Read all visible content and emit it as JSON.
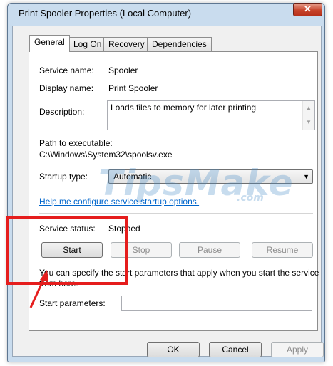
{
  "window": {
    "title": "Print Spooler Properties (Local Computer)",
    "close_glyph": "✕"
  },
  "tabs": [
    {
      "label": "General",
      "active": true
    },
    {
      "label": "Log On",
      "active": false
    },
    {
      "label": "Recovery",
      "active": false
    },
    {
      "label": "Dependencies",
      "active": false
    }
  ],
  "general": {
    "service_name_label": "Service name:",
    "service_name_value": "Spooler",
    "display_name_label": "Display name:",
    "display_name_value": "Print Spooler",
    "description_label": "Description:",
    "description_value": "Loads files to memory for later printing",
    "path_label": "Path to executable:",
    "path_value": "C:\\Windows\\System32\\spoolsv.exe",
    "startup_type_label": "Startup type:",
    "startup_type_value": "Automatic",
    "help_link": "Help me configure service startup options.",
    "status_label": "Service status:",
    "status_value": "Stopped",
    "buttons": {
      "start": "Start",
      "stop": "Stop",
      "pause": "Pause",
      "resume": "Resume"
    },
    "params_hint_line1": "You can specify the start parameters that apply when you start the service",
    "params_hint_line2": "from here.",
    "start_params_label": "Start parameters:",
    "start_params_value": ""
  },
  "footer": {
    "ok": "OK",
    "cancel": "Cancel",
    "apply": "Apply"
  },
  "watermark": {
    "text": "TipsMake",
    "suffix": ".com"
  },
  "colors": {
    "annotation_red": "#e51d1d",
    "link_blue": "#0066cc"
  },
  "icons": {
    "scroll_up": "▲",
    "scroll_down": "▼",
    "dropdown": "▼"
  }
}
